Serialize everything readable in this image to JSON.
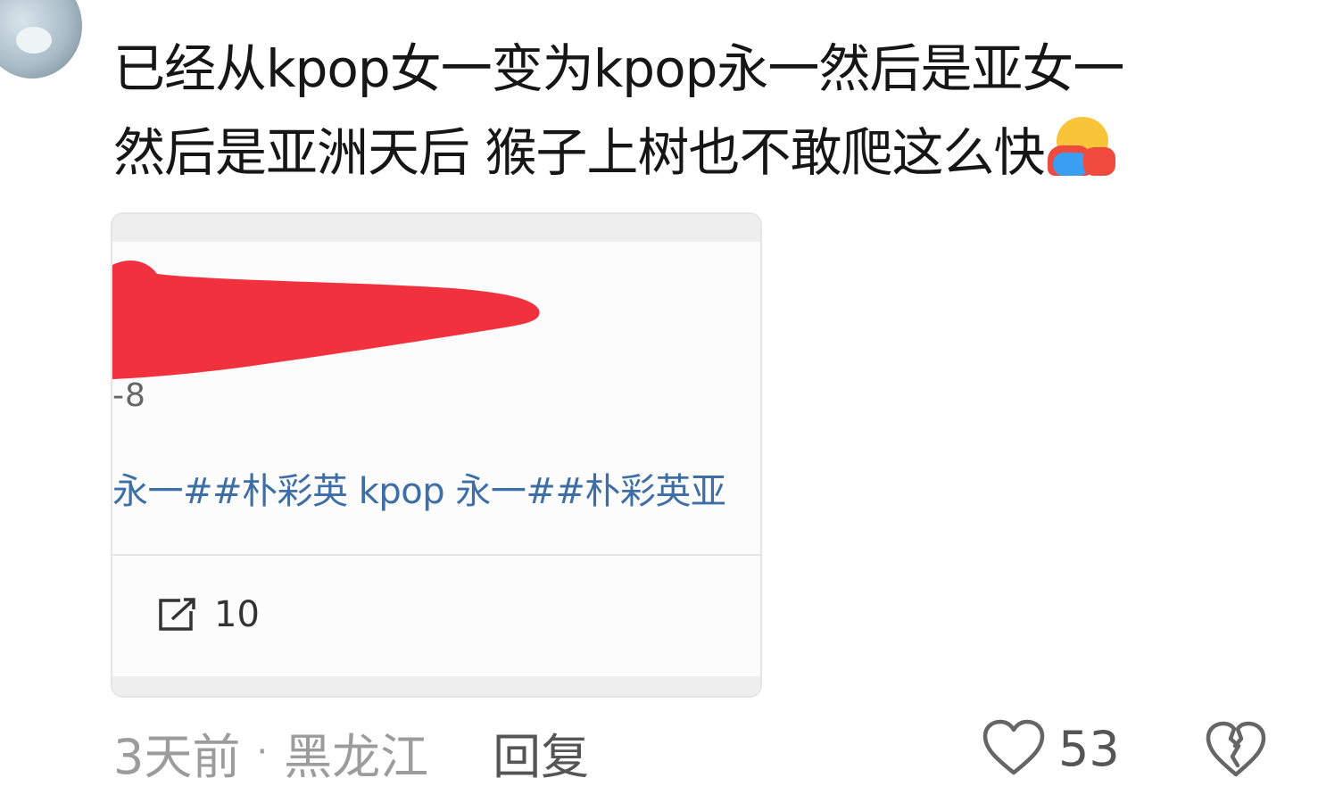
{
  "comment": {
    "line1": "已经从kpop女一变为kpop永一然后是亚女一",
    "line2": "然后是亚洲天后 猴子上树也不敢爬这么快",
    "emoji": "hugging-face-emoji"
  },
  "card": {
    "snippet_number": "-8",
    "tags": "永一##朴彩英 kpop 永一##朴彩英亚",
    "repost_count": "10"
  },
  "footer": {
    "time": "3天前",
    "separator": "·",
    "location": "黑龙江",
    "reply": "回复",
    "like_count": "53"
  },
  "colors": {
    "redaction": "#f2313f",
    "tag_blue": "#3e6ea6",
    "meta_gray": "#9c9c9c"
  }
}
